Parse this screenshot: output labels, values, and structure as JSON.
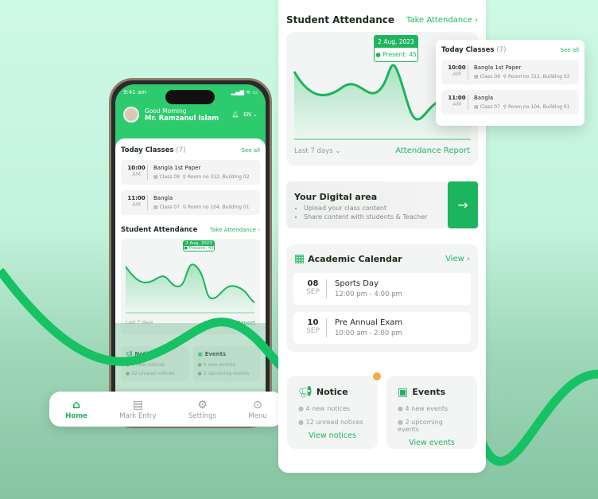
{
  "phone": {
    "time": "9:41 am",
    "greeting": "Good Morning",
    "user": "Mr. Ramzanul Islam",
    "lang": "EN",
    "today_title": "Today Classes",
    "today_count": "(7)",
    "see_all": "See all",
    "classes": [
      {
        "time": "10:00",
        "ampm": "AM",
        "subject": "Bangla 1st Paper",
        "class": "Class 09",
        "room": "Room no 312, Building 02"
      },
      {
        "time": "11:00",
        "ampm": "AM",
        "subject": "Bangla",
        "class": "Class 07",
        "room": "Room no 104, Building 01"
      }
    ],
    "attendance_title": "Student Attendance",
    "take_attendance": "Take Attendance",
    "tooltip_date": "2 Aug, 2023",
    "tooltip_present": "Present: 45",
    "range": "Last 7 days",
    "report": "Attendance Report",
    "notice": {
      "title": "Notice",
      "l1": "4 new notices",
      "l2": "12 unread notices"
    },
    "events": {
      "title": "Events",
      "l1": "4 new events",
      "l2": "2 upcoming events"
    }
  },
  "nav": {
    "items": [
      {
        "label": "Home",
        "icon": "home-icon"
      },
      {
        "label": "Mark Entry",
        "icon": "document-icon"
      },
      {
        "label": "Settings",
        "icon": "gear-icon"
      },
      {
        "label": "Menu",
        "icon": "more-icon"
      }
    ]
  },
  "panel": {
    "attendance_title": "Student Attendance",
    "take_attendance": "Take Attendance",
    "tooltip_date": "2 Aug, 2023",
    "tooltip_present": "Present: 45",
    "range": "Last 7 days",
    "report": "Attendance Report",
    "digital": {
      "title": "Your Digital area",
      "b1": "Upload your class content",
      "b2": "Share content with students & Teacher"
    },
    "calendar": {
      "title": "Academic Calendar",
      "view": "View",
      "events": [
        {
          "day": "08",
          "month": "SEP",
          "name": "Sports Day",
          "time": "12:00 pm - 4:00 pm"
        },
        {
          "day": "10",
          "month": "SEP",
          "name": "Pre Annual Exam",
          "time": "10:00 am - 2:00 pm"
        }
      ]
    },
    "notice": {
      "title": "Notice",
      "l1": "4 new notices",
      "l2": "12 unread notices",
      "link": "View notices"
    },
    "events": {
      "title": "Events",
      "l1": "4 new events",
      "l2": "2 upcoming events",
      "link": "View events"
    }
  },
  "float": {
    "title": "Today Classes",
    "count": "(7)",
    "see_all": "See all"
  },
  "colors": {
    "accent": "#1cb45d",
    "header": "#2ecb6e",
    "badge": "#f7a84a"
  }
}
